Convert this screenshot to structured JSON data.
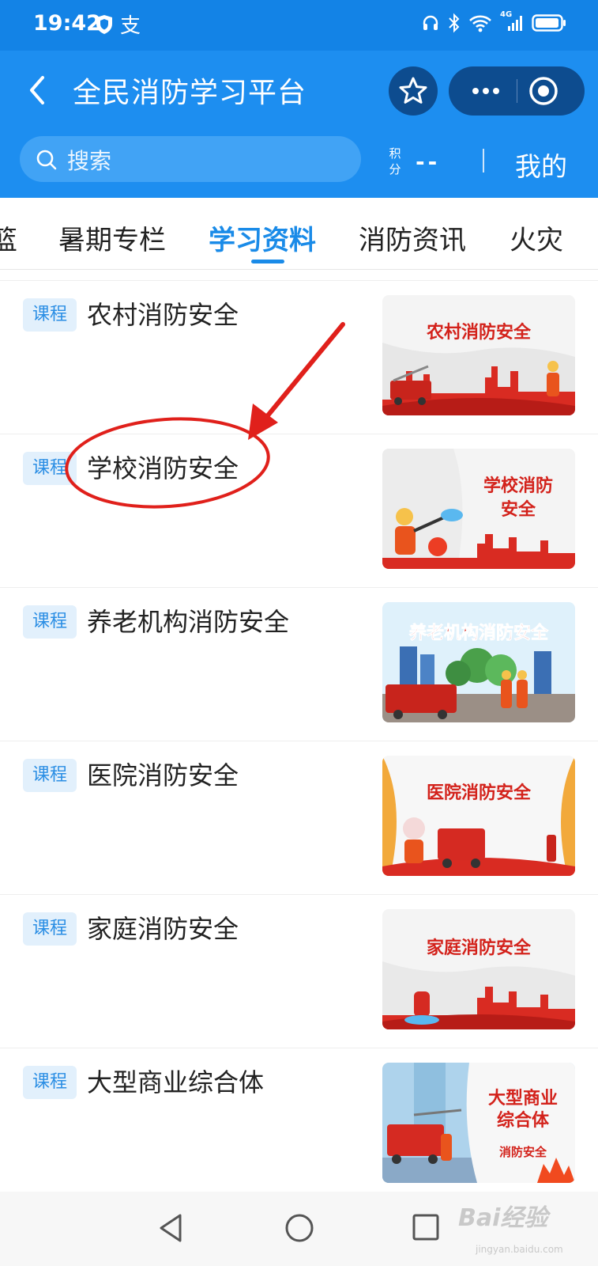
{
  "status_bar": {
    "time": "19:42",
    "alipay_glyph": "支",
    "network": "4G"
  },
  "header": {
    "title": "全民消防学习平台",
    "search_placeholder": "搜索",
    "points_label": "积分",
    "points_value": "--",
    "mine_label": "我的"
  },
  "tabs": [
    {
      "label": "篮",
      "active": false
    },
    {
      "label": "暑期专栏",
      "active": false
    },
    {
      "label": "学习资料",
      "active": true
    },
    {
      "label": "消防资讯",
      "active": false
    },
    {
      "label": "火灾",
      "active": false
    }
  ],
  "courses": [
    {
      "badge": "课程",
      "title": "农村消防安全",
      "thumb_text": "农村消防安全"
    },
    {
      "badge": "课程",
      "title": "学校消防安全",
      "thumb_text": "学校消防",
      "thumb_text2": "安全"
    },
    {
      "badge": "课程",
      "title": "养老机构消防安全",
      "thumb_text": "养老机构消防安全"
    },
    {
      "badge": "课程",
      "title": "医院消防安全",
      "thumb_text": "医院消防安全"
    },
    {
      "badge": "课程",
      "title": "家庭消防安全",
      "thumb_text": "家庭消防安全"
    },
    {
      "badge": "课程",
      "title": "大型商业综合体",
      "thumb_text": "大型商业",
      "thumb_text2": "综合体",
      "thumb_text3": "消防安全"
    }
  ],
  "watermark": {
    "brand": "Bai经验",
    "url": "jingyan.baidu.com"
  },
  "colors": {
    "header_blue": "#1d8ef0",
    "active_tab": "#1a8be8",
    "badge_bg": "#e2f0fc",
    "annotation_red": "#e0201b"
  }
}
